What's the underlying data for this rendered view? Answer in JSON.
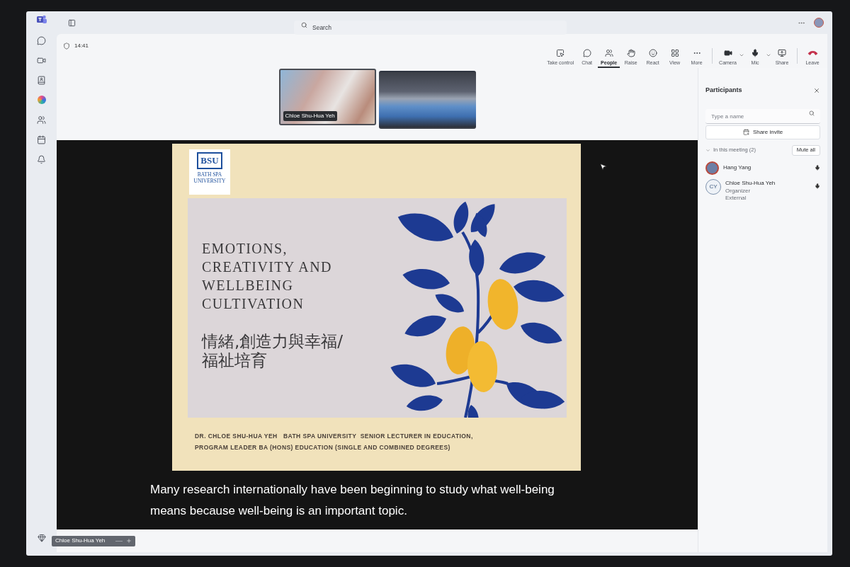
{
  "topbar": {
    "search": {
      "placeholder": "Search"
    }
  },
  "meeting": {
    "timer": "14:41",
    "toolbar": [
      {
        "label": "Take control",
        "selected": false
      },
      {
        "label": "Chat",
        "selected": false
      },
      {
        "label": "People",
        "selected": true
      },
      {
        "label": "Raise",
        "selected": false
      },
      {
        "label": "React",
        "selected": false
      },
      {
        "label": "View",
        "selected": false
      },
      {
        "label": "More",
        "selected": false
      }
    ],
    "devices": [
      {
        "label": "Camera",
        "dropdown": true
      },
      {
        "label": "Mic",
        "dropdown": true
      },
      {
        "label": "Share",
        "dropdown": false
      }
    ],
    "leave": {
      "label": "Leave"
    }
  },
  "video_tiles": [
    {
      "kind": "speaker",
      "name": "Chloe Shu-Hua Yeh",
      "speaking": true
    },
    {
      "kind": "room",
      "speaking": false
    }
  ],
  "slide": {
    "logo_text": "BSU",
    "logo_subtitle_lines": [
      "BATH SPA",
      "UNIVERSITY"
    ],
    "title_lines": [
      "EMOTIONS,",
      "CREATIVITY AND",
      "WELLBEING",
      "CULTIVATION"
    ],
    "chinese_lines": [
      "情緒,創造力與幸福/",
      "福祉培育"
    ],
    "footer_lines": [
      "DR. CHLOE SHU-HUA YEH   BATH SPA UNIVERSITY  SENIOR LECTURER IN EDUCATION,",
      "PROGRAM LEADER BA (HONS) EDUCATION (SINGLE AND COMBINED DEGREES)"
    ]
  },
  "caption_lines": [
    "Many research internationally have been beginning to study what well-being",
    "means because well-being is an important topic."
  ],
  "participants": {
    "title": "Participants",
    "search": {
      "placeholder": "Type a name"
    },
    "share_invite": "Share invite",
    "section": {
      "label": "In this meeting (2)",
      "expanded": true
    },
    "mute_all": "Mute all",
    "people": [
      {
        "kind": "photo",
        "name": "Hang Yang"
      },
      {
        "kind": "initials",
        "initials": "CY",
        "name": "Chloe Shu-Hua Yeh",
        "roles": [
          "Organizer",
          "External"
        ]
      }
    ]
  },
  "bottom_tab": {
    "label": "Chloe Shu-Hua Yeh"
  }
}
